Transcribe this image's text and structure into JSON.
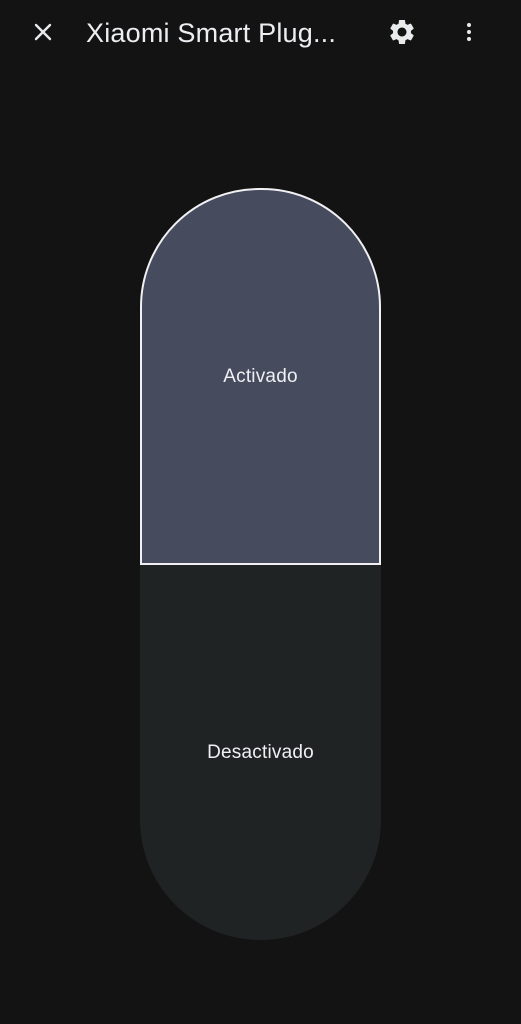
{
  "header": {
    "title": "Xiaomi Smart Plug...",
    "close_icon": "close-icon",
    "settings_icon": "gear-icon",
    "more_icon": "more-vertical-icon"
  },
  "switch": {
    "on_label": "Activado",
    "off_label": "Desactivado",
    "selected": "Activado"
  },
  "colors": {
    "background": "#131313",
    "active_segment": "#464b5e",
    "inactive_segment": "#202324",
    "active_border": "#f1f1f4"
  }
}
